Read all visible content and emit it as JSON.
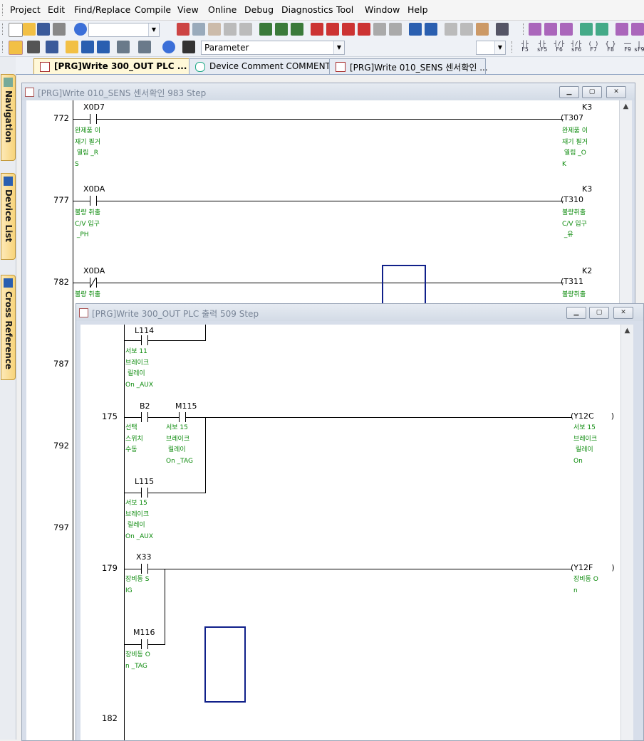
{
  "menu": [
    "Project",
    "Edit",
    "Find/Replace",
    "Compile",
    "View",
    "Online",
    "Debug",
    "Diagnostics",
    "Tool",
    "Window",
    "Help"
  ],
  "toolbar2": {
    "combo_value": "Parameter"
  },
  "function_keys": [
    "F5",
    "sF5",
    "F6",
    "sF6",
    "F7",
    "F8",
    "F9",
    "sF9"
  ],
  "sidebar": [
    "Navigation",
    "Device List",
    "Cross Reference"
  ],
  "tabs": [
    {
      "label": "[PRG]Write 300_OUT PLC ...",
      "active": true
    },
    {
      "label": "Device Comment COMMENT",
      "active": false
    },
    {
      "label": "[PRG]Write 010_SENS 센서확인 ...",
      "active": false
    }
  ],
  "back_window": {
    "title": "[PRG]Write 010_SENS 센서확인 983 Step",
    "steps": [
      "772",
      "777",
      "782",
      "787",
      "792",
      "797"
    ],
    "rungs": [
      {
        "contact": "X0D7",
        "comment": "완제품 이\n재기 필거\n 열림 _R\nS",
        "coil": "T307",
        "k": "K3",
        "coil_comment": "완제품 이\n재기 필거\n 열림 _O\nK"
      },
      {
        "contact": "X0DA",
        "comment": "불량 취출\nC/V 입구\n _PH",
        "coil": "T310",
        "k": "K3",
        "coil_comment": "불량취출\nC/V 입구\n _유"
      },
      {
        "contact": "X0DA",
        "comment": "불량 취출",
        "coil": "T311",
        "k": "K2",
        "coil_comment": "불량취출"
      }
    ]
  },
  "front_window": {
    "title": "[PRG]Write 300_OUT PLC 출력 509 Step",
    "steps": [
      "175",
      "179",
      "182"
    ],
    "l114": {
      "dev": "L114",
      "comment": "서보 11\n브레이크\n 릴레이\nOn _AUX"
    },
    "b2": {
      "dev": "B2",
      "comment": "선택\n스위치\n수동"
    },
    "m115": {
      "dev": "M115",
      "comment": "서보 15\n브레이크\n 릴레이\nOn _TAG"
    },
    "y12c": {
      "dev": "Y12C",
      "comment": "서보 15\n브레이크\n 릴레이\nOn"
    },
    "l115": {
      "dev": "L115",
      "comment": "서보 15\n브레이크\n 릴레이\nOn _AUX"
    },
    "x33": {
      "dev": "X33",
      "comment": "장비동 S\nIG"
    },
    "y12f": {
      "dev": "Y12F",
      "comment": "장비동 O\nn"
    },
    "m116": {
      "dev": "M116",
      "comment": "장비동 O\nn _TAG"
    }
  }
}
